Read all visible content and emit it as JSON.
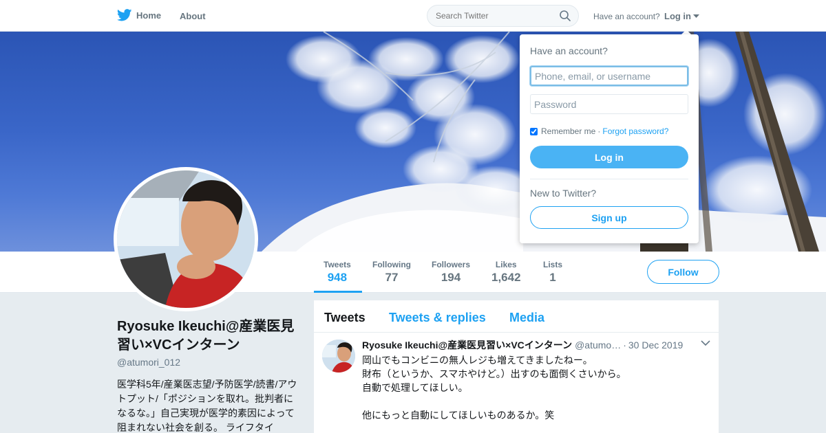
{
  "nav": {
    "home_label": "Home",
    "about_label": "About",
    "search_placeholder": "Search Twitter",
    "have_account": "Have an account?",
    "login_label": "Log in",
    "brand_color": "#1da1f2"
  },
  "profile": {
    "name": "Ryosuke Ikeuchi@産業医見習い×VCインターン",
    "handle": "@atumori_012",
    "bio": "医学科5年/産業医志望/予防医学/読書/アウトプット/「ポジションを取れ。批判者になるな。」自己実現が医学的素因によって阻まれない社会を創る。 ライフタイ"
  },
  "stats": [
    {
      "label": "Tweets",
      "value": "948"
    },
    {
      "label": "Following",
      "value": "77"
    },
    {
      "label": "Followers",
      "value": "194"
    },
    {
      "label": "Likes",
      "value": "1,642"
    },
    {
      "label": "Lists",
      "value": "1"
    }
  ],
  "follow_label": "Follow",
  "timeline": {
    "tabs": [
      "Tweets",
      "Tweets & replies",
      "Media"
    ],
    "tweet": {
      "name": "Ryosuke Ikeuchi@産業医見習い×VCインターン",
      "handle": "@atumo…",
      "date": "30 Dec 2019",
      "lines": [
        "岡山でもコンビニの無人レジも増えてきましたねー。",
        "財布（というか、スマホやけど。）出すのも面倒くさいから。",
        "自動で処理してほしい。",
        "",
        "他にもっと自動にしてほしいものあるか。笑"
      ]
    }
  },
  "login_dropdown": {
    "title": "Have an account?",
    "username_placeholder": "Phone, email, or username",
    "password_placeholder": "Password",
    "remember_label": "Remember me",
    "separator": "·",
    "forgot_label": "Forgot password?",
    "login_button": "Log in",
    "new_label": "New to Twitter?",
    "signup_button": "Sign up"
  }
}
